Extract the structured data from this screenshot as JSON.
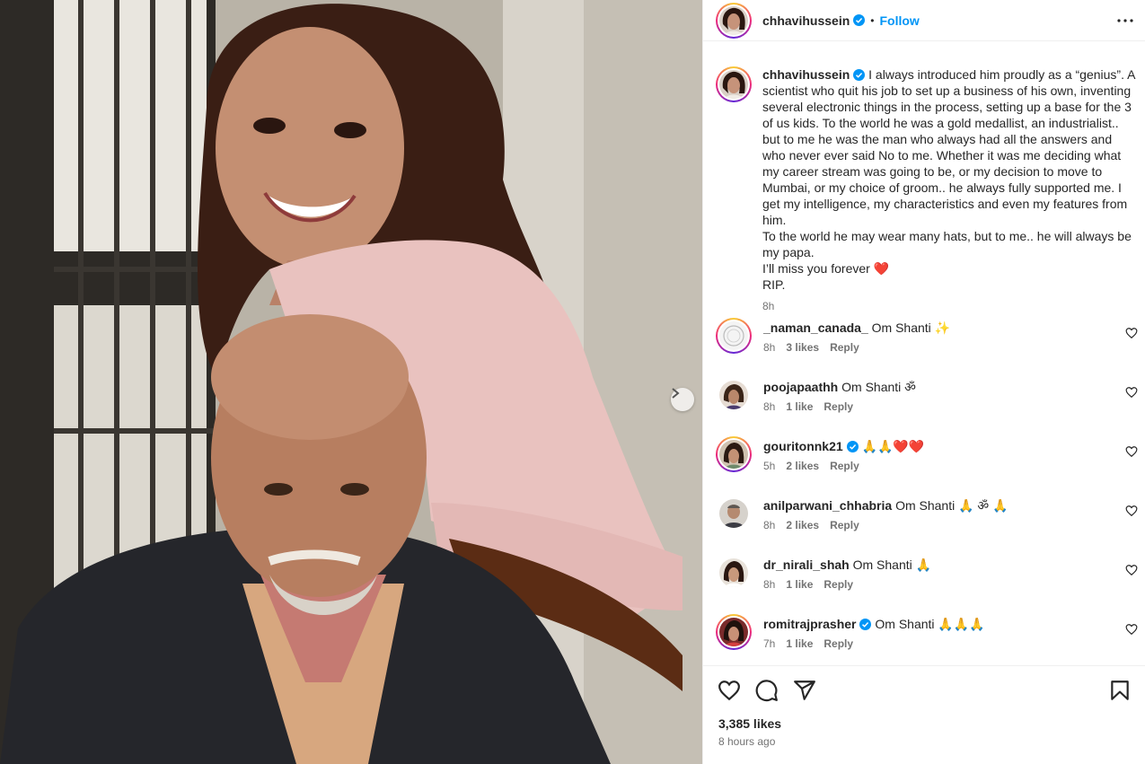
{
  "header": {
    "username": "chhavihussein",
    "dot": "•",
    "follow_label": "Follow",
    "more_icon": "more-horizontal-icon"
  },
  "caption": {
    "username": "chhavihussein",
    "lines": [
      "I always introduced him proudly as a “genius”. A scientist who quit his job to set up a business of his own, inventing several electronic things in the process, setting up a base for the 3 of us kids. To the world he was a gold medallist, an industrialist.. but to me he was the man who always had all the answers and who never ever said No to me. Whether it was me deciding what my career stream was going to be, or my decision to move to Mumbai, or my choice of groom.. he always fully supported me. I get my intelligence, my characteristics and even my features from him.",
      "To the world he may wear many hats, but to me.. he will always be my papa.",
      "I’ll miss you forever ❤️",
      "RIP."
    ],
    "time": "8h"
  },
  "comments": [
    {
      "username": "_naman_canada_",
      "text": "Om Shanti ✨",
      "time": "8h",
      "likes": "3 likes",
      "reply": "Reply"
    },
    {
      "username": "poojapaathh",
      "text": "Om Shanti ॐ",
      "time": "8h",
      "likes": "1 like",
      "reply": "Reply"
    },
    {
      "username": "gouritonnk21",
      "text": "🙏🙏❤️❤️",
      "time": "5h",
      "likes": "2 likes",
      "reply": "Reply"
    },
    {
      "username": "anilparwani_chhabria",
      "text": "Om Shanti 🙏 ॐ 🙏",
      "time": "8h",
      "likes": "2 likes",
      "reply": "Reply"
    },
    {
      "username": "dr_nirali_shah",
      "text": "Om Shanti 🙏",
      "time": "8h",
      "likes": "1 like",
      "reply": "Reply"
    },
    {
      "username": "romitrajprasher",
      "text": "Om Shanti 🙏🙏🙏",
      "time": "7h",
      "likes": "1 like",
      "reply": "Reply"
    }
  ],
  "footer": {
    "likes": "3,385 likes",
    "time": "8 hours ago"
  },
  "colors": {
    "accent": "#0095f6",
    "verified": "#0095f6",
    "muted": "#737373"
  }
}
